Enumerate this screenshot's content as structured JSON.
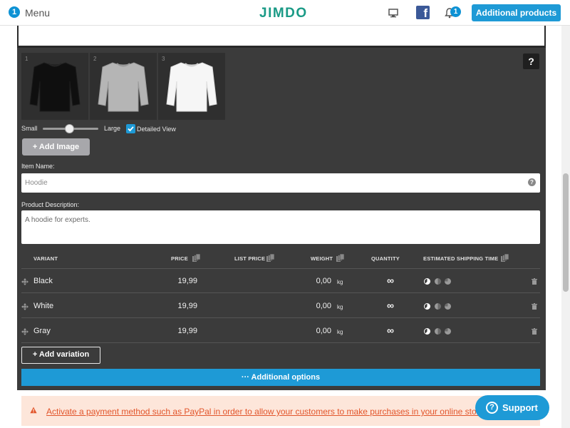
{
  "topbar": {
    "menu_badge": "1",
    "menu_label": "Menu",
    "logo": "JIMDO",
    "notification_count": "1",
    "additional_products": "Additional products"
  },
  "images": {
    "thumbs": [
      {
        "number": "1",
        "color": "#101010"
      },
      {
        "number": "2",
        "color": "#b5b5b5"
      },
      {
        "number": "3",
        "color": "#f5f5f5"
      }
    ],
    "help": "?",
    "size_small": "Small",
    "size_large": "Large",
    "detailed_view": "Detailed View",
    "add_image": "Add Image"
  },
  "item_name": {
    "label": "Item Name:",
    "value": "Hoodie"
  },
  "description": {
    "label": "Product Description:",
    "value": "A hoodie for experts."
  },
  "table": {
    "headers": {
      "variant": "VARIANT",
      "price": "PRICE",
      "list_price": "LIST PRICE",
      "weight": "WEIGHT",
      "quantity": "QUANTITY",
      "shipping": "ESTIMATED SHIPPING TIME"
    },
    "rows": [
      {
        "variant": "Black",
        "price": "19,99",
        "weight": "0,00",
        "unit": "kg",
        "quantity": "∞"
      },
      {
        "variant": "White",
        "price": "19,99",
        "weight": "0,00",
        "unit": "kg",
        "quantity": "∞"
      },
      {
        "variant": "Gray",
        "price": "19,99",
        "weight": "0,00",
        "unit": "kg",
        "quantity": "∞"
      }
    ]
  },
  "add_variation": "Add variation",
  "additional_options": "··· Additional options",
  "alert": {
    "text": "Activate a payment method such as PayPal in order to allow your customers to make purchases in your online store."
  },
  "support": {
    "icon": "?",
    "label": "Support"
  },
  "colors": {
    "accent": "#1e9ad6",
    "brand": "#1a9a86",
    "panel": "#3b3b3b",
    "alert": "#e2552b"
  }
}
